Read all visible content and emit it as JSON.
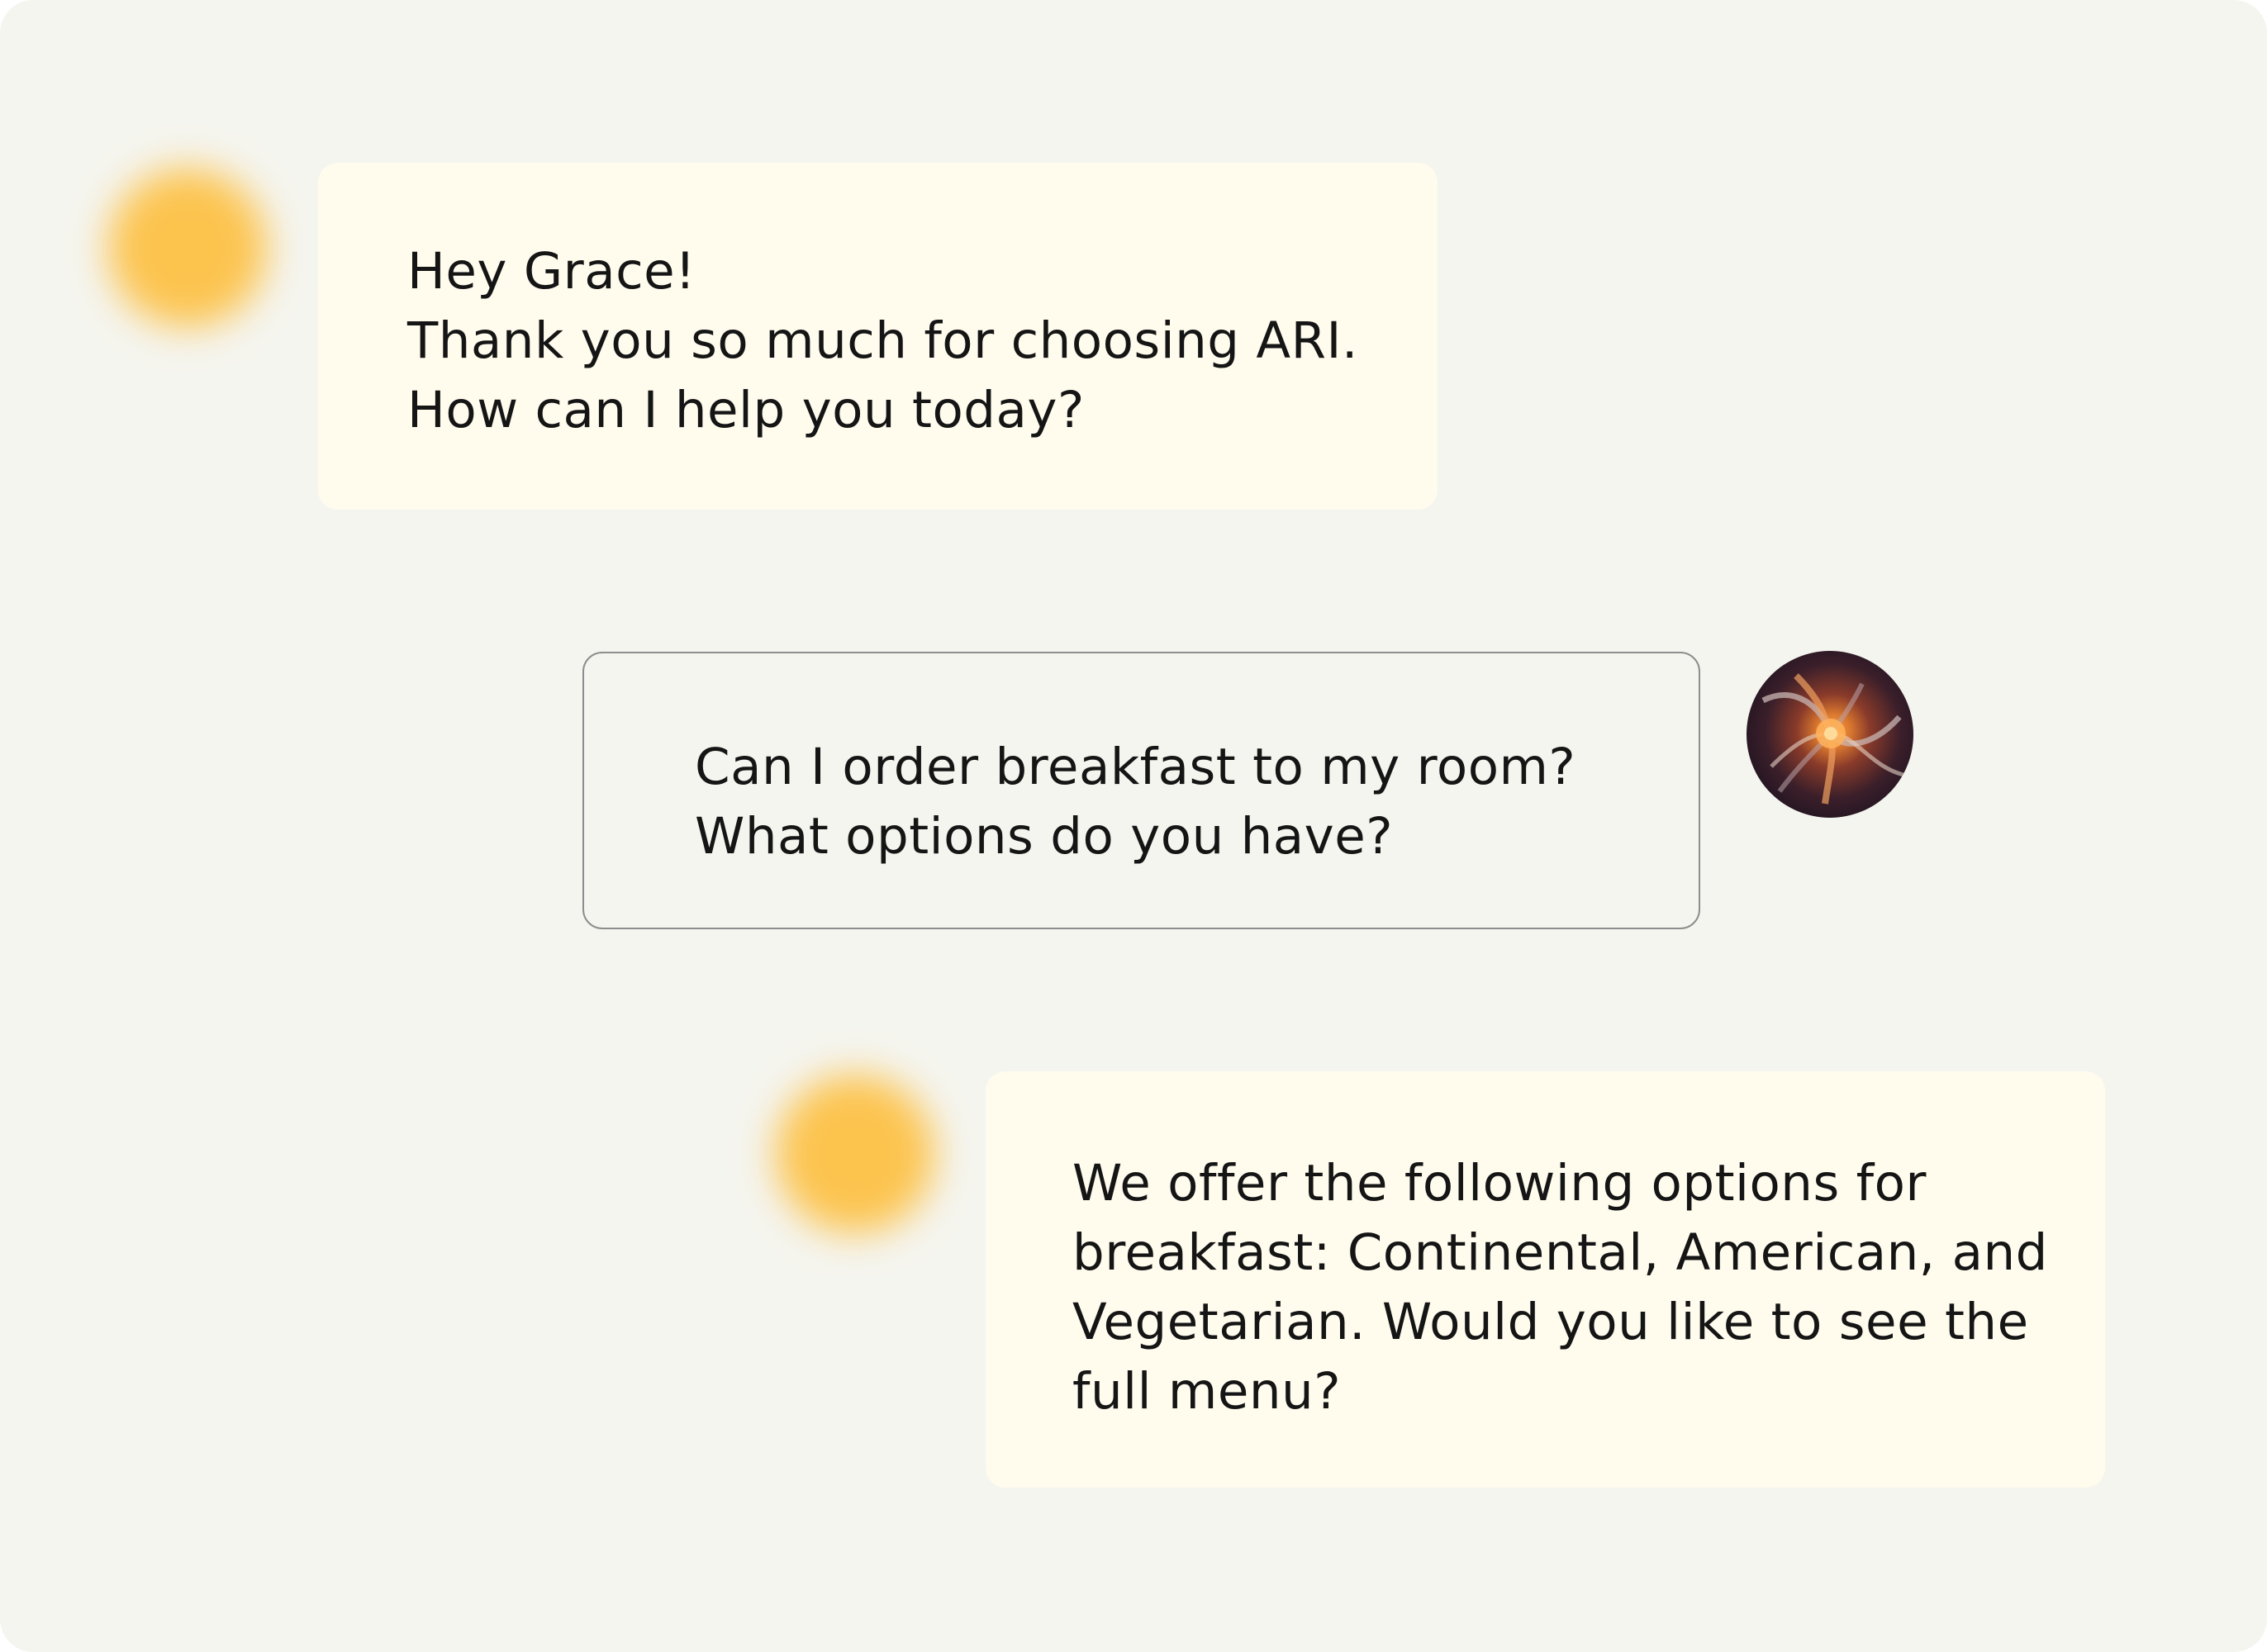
{
  "conversation": {
    "messages": [
      {
        "sender": "bot",
        "lines": [
          "Hey Grace!",
          "Thank you so much for choosing ARI.",
          "How can I help you today?"
        ]
      },
      {
        "sender": "user",
        "lines": [
          "Can I order breakfast to my room?",
          "What options do you have?"
        ]
      },
      {
        "sender": "bot",
        "lines": [
          "We offer the following options for",
          "breakfast: Continental, American, and",
          "Vegetarian. Would you like to see the",
          "full menu?"
        ]
      }
    ]
  },
  "colors": {
    "background": "#f5f5ef",
    "bot_bubble": "#fffcee",
    "bot_avatar_glow": "#fcc24c",
    "user_bubble_border": "#8d8d8d",
    "text": "#151515"
  },
  "icons": {
    "bot_avatar": "glowing-orb-icon",
    "user_avatar": "user-photo-avatar"
  }
}
